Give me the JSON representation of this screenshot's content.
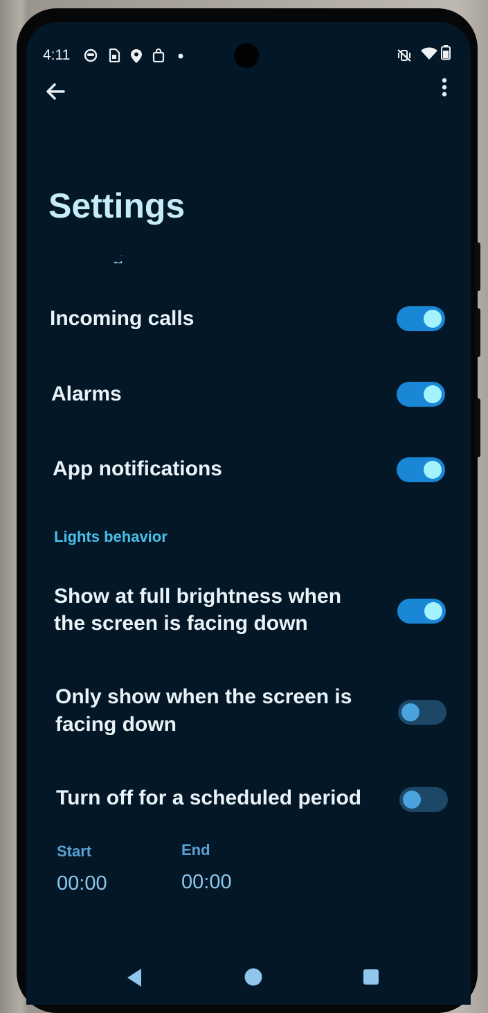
{
  "status_bar": {
    "time": "4:11",
    "left_icons": [
      "face-icon",
      "sim-icon",
      "location-pin-icon",
      "bag-icon",
      "dot-icon"
    ],
    "right_icons": [
      "vibrate-off-icon",
      "wifi-icon",
      "battery-icon"
    ]
  },
  "app_bar": {
    "back_icon": "arrow-left-icon",
    "menu_icon": "more-vertical-icon"
  },
  "page": {
    "title": "Settings"
  },
  "items": [
    {
      "label": "Incoming calls",
      "enabled": true
    },
    {
      "label": "Alarms",
      "enabled": true
    },
    {
      "label": "App notifications",
      "enabled": true
    }
  ],
  "lights_section": {
    "header": "Lights behavior",
    "items": [
      {
        "label_line1": "Show at full brightness when",
        "label_line2": "the screen is facing down",
        "enabled": true
      },
      {
        "label_line1": "Only show when the screen is",
        "label_line2": "facing down",
        "enabled": false
      },
      {
        "label_line1": "Turn off for a scheduled period",
        "label_line2": "",
        "enabled": false
      }
    ]
  },
  "schedule": {
    "start_label": "Start",
    "start_value": "00:00",
    "end_label": "End",
    "end_value": "00:00"
  },
  "nav_bar": {
    "icons": [
      "back-triangle-icon",
      "home-circle-icon",
      "recents-square-icon"
    ]
  },
  "colors": {
    "background": "#031727",
    "accent": "#48c1ea",
    "toggle_on": "#1a86d6",
    "toggle_off": "#1c4766"
  }
}
